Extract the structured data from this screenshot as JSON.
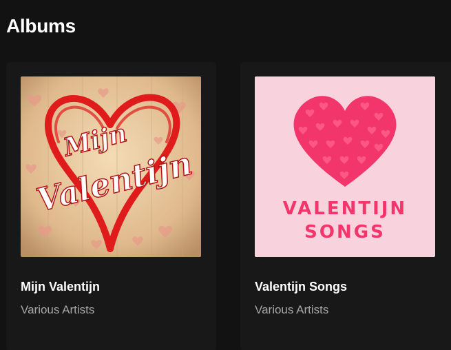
{
  "section": {
    "title": "Albums"
  },
  "albums": [
    {
      "title": "Mijn Valentijn",
      "artist": "Various Artists",
      "cover_text_line1": "Mijn",
      "cover_text_line2": "Valentijn",
      "cover_colors": {
        "background": "#e8c9a0",
        "ribbon": "#e01b1b",
        "text": "#ffffff"
      }
    },
    {
      "title": "Valentijn Songs",
      "artist": "Various Artists",
      "cover_text_line1": "VALENTIJN",
      "cover_text_line2": "SONGS",
      "cover_colors": {
        "background": "#f8d3dd",
        "heart": "#f2356b",
        "text": "#f2356b"
      }
    }
  ],
  "colors": {
    "page_background": "#121212",
    "card_background": "#181818",
    "title_text": "#ffffff",
    "subtitle_text": "#a7a7a7"
  }
}
